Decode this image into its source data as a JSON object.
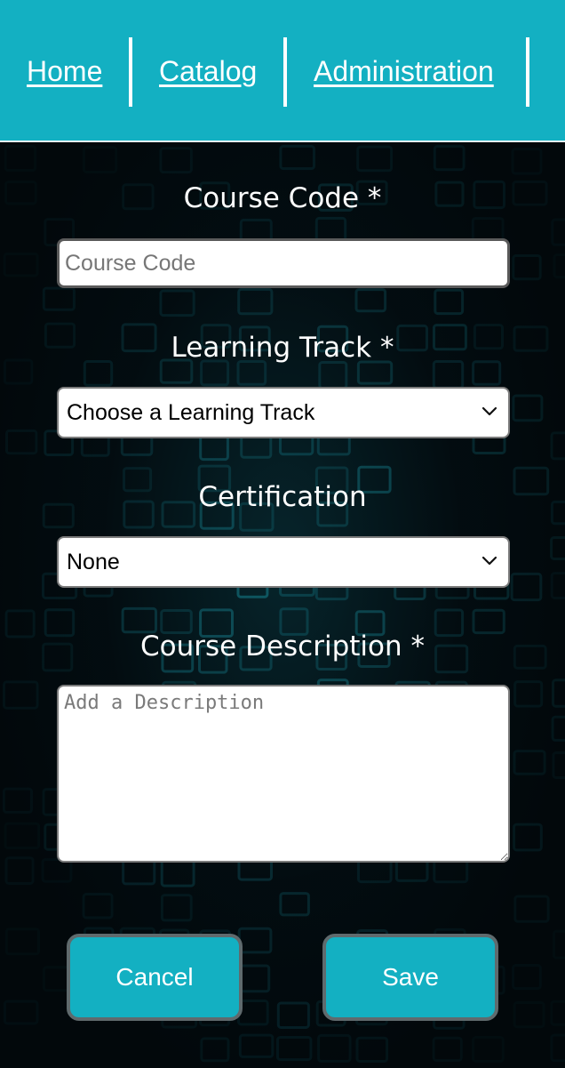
{
  "nav": {
    "items": [
      {
        "label": "Home"
      },
      {
        "label": "Catalog"
      },
      {
        "label": "Administration"
      }
    ]
  },
  "form": {
    "course_code": {
      "label": "Course Code *",
      "placeholder": "Course Code",
      "value": ""
    },
    "learning_track": {
      "label": "Learning Track *",
      "selected": "Choose a Learning Track"
    },
    "certification": {
      "label": "Certification",
      "selected": "None"
    },
    "description": {
      "label": "Course Description *",
      "placeholder": "Add a Description",
      "value": ""
    }
  },
  "actions": {
    "cancel_label": "Cancel",
    "save_label": "Save"
  },
  "colors": {
    "accent": "#13b0c2",
    "background": "#02080b",
    "text": "#ffffff"
  },
  "icons": {
    "select_arrow": "chevron-down-icon"
  }
}
